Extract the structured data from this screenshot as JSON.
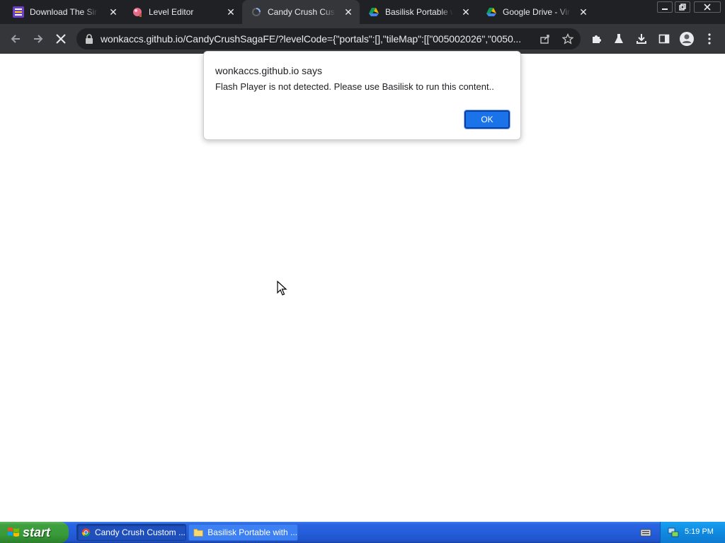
{
  "browser": {
    "tabs": [
      {
        "title": "Download The Simple",
        "favicon": "tool-favicon",
        "active": false
      },
      {
        "title": "Level Editor",
        "favicon": "candy-favicon",
        "active": false
      },
      {
        "title": "Candy Crush Custom",
        "favicon": "loading-favicon",
        "active": true
      },
      {
        "title": "Basilisk Portable with",
        "favicon": "google-drive-favicon",
        "active": false
      },
      {
        "title": "Google Drive - Virus",
        "favicon": "google-drive-favicon",
        "active": false
      }
    ],
    "address_bar": {
      "url": "wonkaccs.github.io/CandyCrushSagaFE/?levelCode={\"portals\":[],\"tileMap\":[[\"005002026\",\"0050..."
    }
  },
  "dialog": {
    "title": "wonkaccs.github.io says",
    "message": "Flash Player is not detected. Please use Basilisk to run this content..",
    "ok_label": "OK"
  },
  "taskbar": {
    "start_label": "start",
    "items": [
      {
        "label": "Candy Crush Custom ...",
        "icon": "chrome-icon",
        "active": true
      },
      {
        "label": "Basilisk Portable with ...",
        "icon": "folder-icon",
        "active": false
      }
    ],
    "clock": "5:19 PM"
  },
  "colors": {
    "chrome_dark": "#202124",
    "chrome_toolbar": "#35363a",
    "dialog_button": "#1a73e8",
    "taskbar_blue": "#245edb",
    "start_green": "#3f9f3f"
  }
}
